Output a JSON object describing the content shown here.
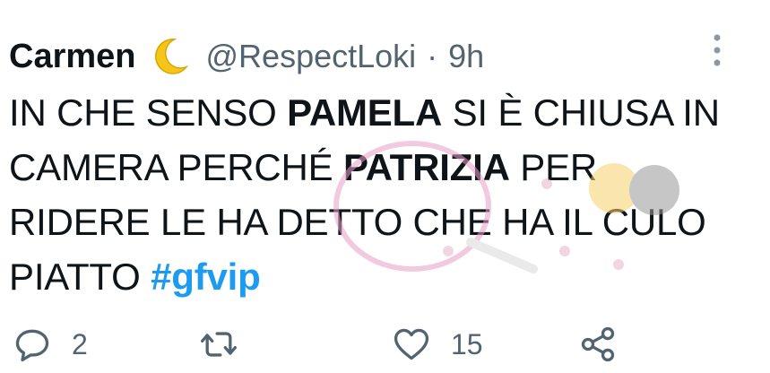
{
  "tweet": {
    "author_name": "Carmen",
    "handle": "@RespectLoki",
    "separator": "·",
    "time": "9h",
    "text_parts": {
      "p1": "IN CHE SENSO ",
      "p2": "PAMELA",
      "p3": " SI È CHIUSA IN CAMERA PERCHÉ ",
      "p4": "PATRIZIA",
      "p5": " PER RIDERE LE HA DETTO CHE HA IL CULO PIATTO ",
      "hashtag": "#gfvip"
    }
  },
  "actions": {
    "reply_count": "2",
    "retweet_count": "",
    "like_count": "15"
  },
  "icons": [
    "crescent-moon-emoji",
    "more-icon",
    "reply-icon",
    "retweet-icon",
    "like-icon",
    "share-icon"
  ],
  "colors": {
    "text": "#0f1419",
    "muted": "#536471",
    "link": "#1d9bf0",
    "moon": "#f5c518"
  }
}
